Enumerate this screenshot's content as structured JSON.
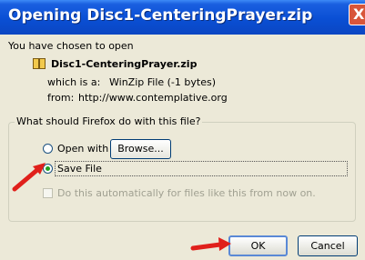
{
  "window": {
    "title": "Opening Disc1-CenteringPrayer.zip",
    "close_label": "X"
  },
  "intro": {
    "text": "You have chosen to open"
  },
  "file": {
    "name": "Disc1-CenteringPrayer.zip",
    "type_label": "which is a:",
    "type_value": "WinZip File (-1 bytes)",
    "from_label": "from:",
    "from_value": "http://www.contemplative.org"
  },
  "action_group": {
    "legend": "What should Firefox do with this file?",
    "open_with_label": "Open with",
    "browse_label": "Browse...",
    "save_file_label": "Save File",
    "auto_label": "Do this automatically for files like this from now on.",
    "selected": "save_file",
    "auto_checked": false
  },
  "buttons": {
    "ok_label": "OK",
    "cancel_label": "Cancel"
  },
  "colors": {
    "titlebar": "#0a4fd4",
    "dialog_bg": "#ece9d8",
    "arrow": "#e0201b",
    "radio_check": "#21a121"
  }
}
